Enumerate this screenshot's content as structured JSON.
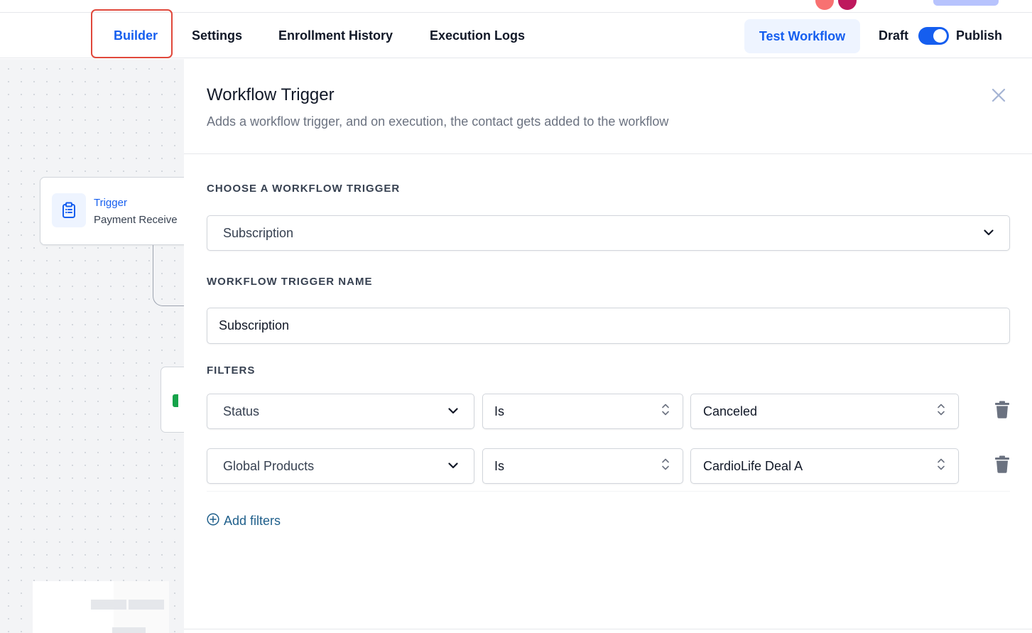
{
  "nav": {
    "tabs": [
      {
        "label": "Builder",
        "active": true
      },
      {
        "label": "Settings",
        "active": false
      },
      {
        "label": "Enrollment History",
        "active": false
      },
      {
        "label": "Execution Logs",
        "active": false
      }
    ],
    "test_button": "Test Workflow",
    "draft_label": "Draft",
    "publish_label": "Publish",
    "publish_toggle_on": true
  },
  "canvas": {
    "trigger_node": {
      "title": "Trigger",
      "subtitle": "Payment Receive",
      "icon": "clipboard-list-icon"
    }
  },
  "panel": {
    "title": "Workflow Trigger",
    "description": "Adds a workflow trigger, and on execution, the contact gets added to the workflow",
    "choose_trigger_label": "CHOOSE A WORKFLOW TRIGGER",
    "trigger_select_value": "Subscription",
    "trigger_name_label": "WORKFLOW TRIGGER NAME",
    "trigger_name_value": "Subscription",
    "filters_label": "FILTERS",
    "filters": [
      {
        "field": "Status",
        "operator": "Is",
        "value": "Canceled"
      },
      {
        "field": "Global Products",
        "operator": "Is",
        "value": "CardioLife Deal A"
      }
    ],
    "add_filters_label": "Add filters"
  },
  "colors": {
    "accent": "#155eef",
    "highlight_border": "#e0483b",
    "add_filters": "#1f5f8b"
  }
}
